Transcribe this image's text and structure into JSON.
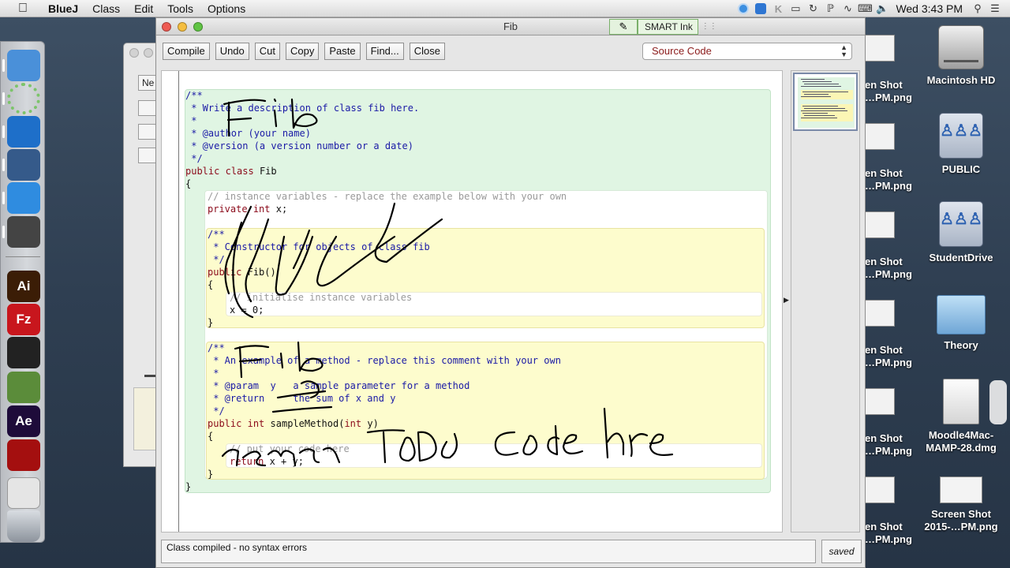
{
  "menubar": {
    "app_name": "BlueJ",
    "menus": [
      "Class",
      "Edit",
      "Tools",
      "Options"
    ],
    "clock": "Wed 3:43 PM"
  },
  "window": {
    "title": "Fib",
    "smart_ink_label": "SMART Ink",
    "toolbar": [
      "Compile",
      "Undo",
      "Cut",
      "Copy",
      "Paste",
      "Find...",
      "Close"
    ],
    "view_selector": "Source Code",
    "status": "Class compiled - no syntax errors",
    "saved_label": "saved"
  },
  "code_lines": [
    {
      "text": "/**",
      "kind": "doc",
      "indent": 0
    },
    {
      "text": " * Write a description of class fib here.",
      "kind": "doc",
      "indent": 0
    },
    {
      "text": " *",
      "kind": "doc",
      "indent": 0
    },
    {
      "text": " * @author (your name)",
      "kind": "doc",
      "indent": 0
    },
    {
      "text": " * @version (a version number or a date)",
      "kind": "doc",
      "indent": 0
    },
    {
      "text": " */",
      "kind": "doc",
      "indent": 0
    },
    {
      "text": "public class Fib",
      "kind": "decl",
      "indent": 0
    },
    {
      "text": "{",
      "kind": "plain",
      "indent": 0
    },
    {
      "text": "// instance variables - replace the example below with your own",
      "kind": "com",
      "indent": 1
    },
    {
      "text": "private int x;",
      "kind": "decl",
      "indent": 1
    },
    {
      "text": "",
      "kind": "plain",
      "indent": 1
    },
    {
      "text": "/**",
      "kind": "doc",
      "indent": 1
    },
    {
      "text": " * Constructor for objects of class fib",
      "kind": "doc",
      "indent": 1
    },
    {
      "text": " */",
      "kind": "doc",
      "indent": 1
    },
    {
      "text": "public Fib()",
      "kind": "decl",
      "indent": 1
    },
    {
      "text": "{",
      "kind": "plain",
      "indent": 1
    },
    {
      "text": "// initialise instance variables",
      "kind": "com",
      "indent": 2
    },
    {
      "text": "x = 0;",
      "kind": "plain",
      "indent": 2
    },
    {
      "text": "}",
      "kind": "plain",
      "indent": 1
    },
    {
      "text": "",
      "kind": "plain",
      "indent": 1
    },
    {
      "text": "/**",
      "kind": "doc",
      "indent": 1
    },
    {
      "text": " * An example of a method - replace this comment with your own",
      "kind": "doc",
      "indent": 1
    },
    {
      "text": " *",
      "kind": "doc",
      "indent": 1
    },
    {
      "text": " * @param  y   a sample parameter for a method",
      "kind": "doc",
      "indent": 1
    },
    {
      "text": " * @return     the sum of x and y",
      "kind": "doc",
      "indent": 1
    },
    {
      "text": " */",
      "kind": "doc",
      "indent": 1
    },
    {
      "text": "public int sampleMethod(int y)",
      "kind": "decl",
      "indent": 1
    },
    {
      "text": "{",
      "kind": "plain",
      "indent": 1
    },
    {
      "text": "// put your code here",
      "kind": "com",
      "indent": 2
    },
    {
      "text": "return x + y;",
      "kind": "decl",
      "indent": 2
    },
    {
      "text": "}",
      "kind": "plain",
      "indent": 1
    },
    {
      "text": "}",
      "kind": "plain",
      "indent": 0
    }
  ],
  "keywords": [
    "public",
    "private",
    "class",
    "int",
    "return"
  ],
  "desktop": {
    "icons": [
      {
        "label": "Macintosh HD",
        "type": "drive-icon"
      },
      {
        "label": "PUBLIC",
        "type": "network-drive-icon"
      },
      {
        "label": "StudentDrive",
        "type": "network-drive-icon"
      },
      {
        "label": "Theory",
        "type": "folder-icon"
      },
      {
        "label": "Moodle4Mac-MAMP-28.dmg",
        "type": "disk-image-icon"
      },
      {
        "label": "Screen Shot 2015-…PM.png",
        "type": "screenshot-icon"
      }
    ],
    "partial_labels": [
      [
        "en Shot",
        "…PM.png"
      ],
      [
        "en Shot",
        "…PM.png"
      ],
      [
        "en Shot",
        "…PM.png"
      ],
      [
        "en Shot",
        "…PM.png"
      ],
      [
        "en Shot",
        "…PM.png"
      ],
      [
        "en Shot",
        "…PM.png"
      ]
    ]
  },
  "background_window": {
    "field_label": "Ne"
  },
  "dock": [
    {
      "name": "finder-icon",
      "color": "#4a90d9"
    },
    {
      "name": "spinner-icon",
      "color": "#7cc46a"
    },
    {
      "name": "teamviewer-icon",
      "color": "#1e6fc9"
    },
    {
      "name": "bluej-icon",
      "color": "#355a8a"
    },
    {
      "name": "textedit-icon",
      "color": "#2f8ce0"
    },
    {
      "name": "magnifier-app-icon",
      "color": "#444444"
    },
    {
      "name": "illustrator-icon",
      "color": "#3b1d06",
      "text": "Ai"
    },
    {
      "name": "filezilla-icon",
      "color": "#c8161d",
      "text": "Fz"
    },
    {
      "name": "piano-icon",
      "color": "#222222"
    },
    {
      "name": "character-icon",
      "color": "#5b8c3a"
    },
    {
      "name": "after-effects-icon",
      "color": "#1e0b3a",
      "text": "Ae"
    },
    {
      "name": "acrobat-icon",
      "color": "#a40f0f"
    },
    {
      "name": "preview-icon",
      "color": "#e5e5e5"
    },
    {
      "name": "trash-icon",
      "color": "#9aa0a8"
    }
  ]
}
